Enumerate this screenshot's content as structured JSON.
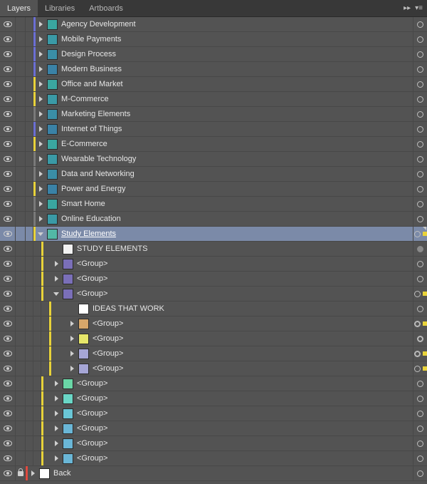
{
  "tabs": [
    "Layers",
    "Libraries",
    "Artboards"
  ],
  "active_tab": 0,
  "colors": {
    "purple": "#6b6fd4",
    "yellow": "#e8d23a",
    "gray": "#7a7a7a",
    "red": "#e04a3f",
    "teal1": "#3aa6a0",
    "teal2": "#3a9aa6",
    "teal3": "#3a8ea6",
    "teal4": "#3a82a6",
    "teal5": "#52b8a6",
    "white": "#ffffff",
    "whitex": "#f2f2f2",
    "purple2": "#7a6fb8",
    "lav": "#a6a6d6",
    "orange": "#d6a66a",
    "yellow2": "#e6e66a",
    "mint": "#6ad6a6",
    "mint2": "#6ad6c6",
    "teal6": "#6ac6d6",
    "cyan": "#6ab6d6"
  },
  "rows": [
    {
      "indent": 1,
      "cbar": "purple",
      "arrow": "closed",
      "thumb": "teal1",
      "label": "Agency Development",
      "target": "ring"
    },
    {
      "indent": 1,
      "cbar": "purple",
      "arrow": "closed",
      "thumb": "teal2",
      "label": "Mobile Payments",
      "target": "ring"
    },
    {
      "indent": 1,
      "cbar": "purple",
      "arrow": "closed",
      "thumb": "teal3",
      "label": "Design Process",
      "target": "ring"
    },
    {
      "indent": 1,
      "cbar": "purple",
      "arrow": "closed",
      "thumb": "teal4",
      "label": "Modern Business",
      "target": "ring"
    },
    {
      "indent": 1,
      "cbar": "yellow",
      "arrow": "closed",
      "thumb": "teal1",
      "label": "Office and Market",
      "target": "ring"
    },
    {
      "indent": 1,
      "cbar": "yellow",
      "arrow": "closed",
      "thumb": "teal2",
      "label": "M-Commerce",
      "target": "ring"
    },
    {
      "indent": 1,
      "cbar": "gray",
      "arrow": "closed",
      "thumb": "teal3",
      "label": "Marketing Elements",
      "target": "ring"
    },
    {
      "indent": 1,
      "cbar": "purple",
      "arrow": "closed",
      "thumb": "teal4",
      "label": "Internet of Things",
      "target": "ring"
    },
    {
      "indent": 1,
      "cbar": "yellow",
      "arrow": "closed",
      "thumb": "teal1",
      "label": "E-Commerce",
      "target": "ring"
    },
    {
      "indent": 1,
      "cbar": "gray",
      "arrow": "closed",
      "thumb": "teal2",
      "label": "Wearable Technology",
      "target": "ring"
    },
    {
      "indent": 1,
      "cbar": "gray",
      "arrow": "closed",
      "thumb": "teal3",
      "label": "Data and Networking",
      "target": "ring"
    },
    {
      "indent": 1,
      "cbar": "yellow",
      "arrow": "closed",
      "thumb": "teal4",
      "label": "Power and Energy",
      "target": "ring"
    },
    {
      "indent": 1,
      "cbar": "gray",
      "arrow": "closed",
      "thumb": "teal1",
      "label": "Smart Home",
      "target": "ring"
    },
    {
      "indent": 1,
      "cbar": "gray",
      "arrow": "closed",
      "thumb": "teal2",
      "label": "Online Education",
      "target": "ring"
    },
    {
      "indent": 1,
      "cbar": "yellow",
      "arrow": "open",
      "thumb": "teal5",
      "label": "Study Elements",
      "target": "ring",
      "selected": true,
      "badge": "yellow",
      "sel_mark": true
    },
    {
      "indent": 2,
      "cbar": "yellow",
      "arrow": "none",
      "thumb": "whitex",
      "label": "STUDY ELEMENTS",
      "target": "filled"
    },
    {
      "indent": 2,
      "cbar": "yellow",
      "arrow": "closed",
      "thumb": "purple2",
      "label": "<Group>",
      "target": "ring"
    },
    {
      "indent": 2,
      "cbar": "yellow",
      "arrow": "closed",
      "thumb": "purple2",
      "label": "<Group>",
      "target": "ring"
    },
    {
      "indent": 2,
      "cbar": "yellow",
      "arrow": "open",
      "thumb": "purple2",
      "label": "<Group>",
      "target": "ring",
      "badge": "yellow"
    },
    {
      "indent": 3,
      "cbar": "yellow",
      "arrow": "none",
      "thumb": "white",
      "label": "IDEAS THAT WORK",
      "target": "ring"
    },
    {
      "indent": 3,
      "cbar": "yellow",
      "arrow": "closed",
      "thumb": "orange",
      "label": "<Group>",
      "target": "db",
      "badge": "yellow"
    },
    {
      "indent": 3,
      "cbar": "yellow",
      "arrow": "closed",
      "thumb": "yellow2",
      "label": "<Group>",
      "target": "db"
    },
    {
      "indent": 3,
      "cbar": "yellow",
      "arrow": "closed",
      "thumb": "lav",
      "label": "<Group>",
      "target": "db",
      "badge": "yellow"
    },
    {
      "indent": 3,
      "cbar": "yellow",
      "arrow": "closed",
      "thumb": "lav",
      "label": "<Group>",
      "target": "ring",
      "badge": "yellow"
    },
    {
      "indent": 2,
      "cbar": "yellow",
      "arrow": "closed",
      "thumb": "mint",
      "label": "<Group>",
      "target": "ring"
    },
    {
      "indent": 2,
      "cbar": "yellow",
      "arrow": "closed",
      "thumb": "mint2",
      "label": "<Group>",
      "target": "ring"
    },
    {
      "indent": 2,
      "cbar": "yellow",
      "arrow": "closed",
      "thumb": "teal6",
      "label": "<Group>",
      "target": "ring"
    },
    {
      "indent": 2,
      "cbar": "yellow",
      "arrow": "closed",
      "thumb": "cyan",
      "label": "<Group>",
      "target": "ring"
    },
    {
      "indent": 2,
      "cbar": "yellow",
      "arrow": "closed",
      "thumb": "cyan",
      "label": "<Group>",
      "target": "ring"
    },
    {
      "indent": 2,
      "cbar": "yellow",
      "arrow": "closed",
      "thumb": "cyan",
      "label": "<Group>",
      "target": "ring"
    },
    {
      "indent": 0,
      "cbar": "red",
      "arrow": "closed",
      "thumb": "white",
      "label": "Back",
      "target": "ring",
      "locked": true
    }
  ]
}
